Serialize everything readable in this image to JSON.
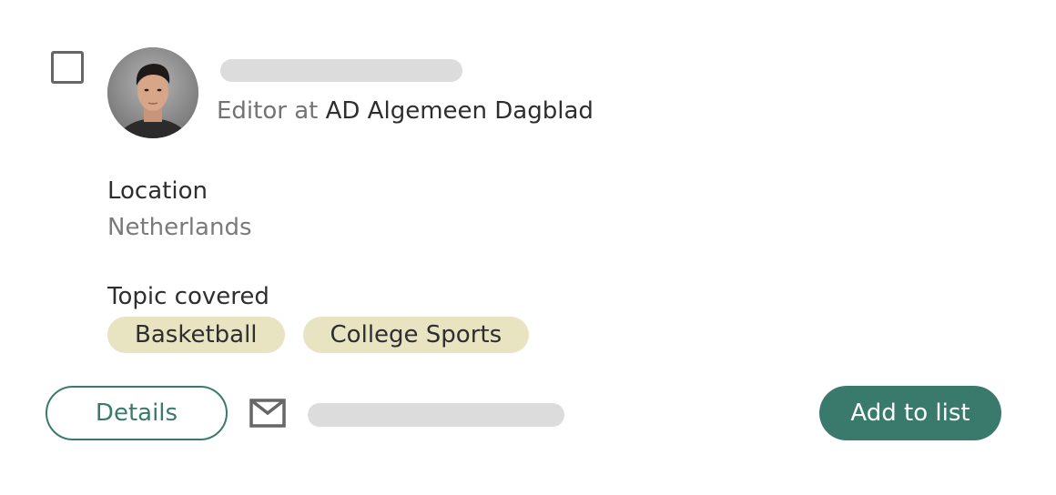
{
  "contact": {
    "role_prefix": "Editor at",
    "company": "AD Algemeen Dagblad",
    "location_label": "Location",
    "location_value": "Netherlands",
    "topics_label": "Topic covered",
    "topics": [
      "Basketball",
      "College Sports"
    ]
  },
  "actions": {
    "details_label": "Details",
    "add_to_list_label": "Add to list"
  },
  "icons": {
    "email": "mail-icon",
    "select": "checkbox-icon"
  },
  "colors": {
    "accent": "#3a7a6c",
    "chip_background": "#e8e4c2",
    "placeholder": "#dcdcdc"
  }
}
